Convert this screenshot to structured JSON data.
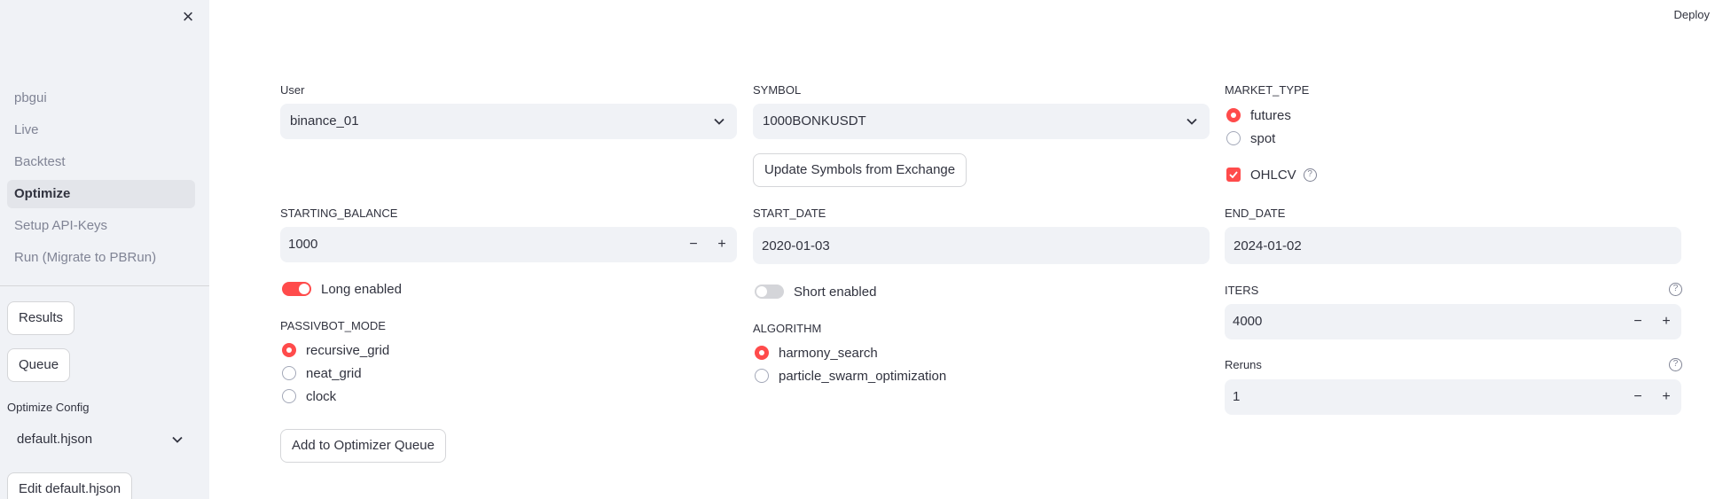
{
  "sidebar": {
    "close_icon": "close-icon",
    "nav": [
      {
        "label": "pbgui"
      },
      {
        "label": "Live"
      },
      {
        "label": "Backtest"
      },
      {
        "label": "Optimize"
      },
      {
        "label": "Setup API-Keys"
      },
      {
        "label": "Run (Migrate to PBRun)"
      }
    ],
    "active_index": 3,
    "results_label": "Results",
    "queue_label": "Queue",
    "config_label": "Optimize Config",
    "config_value": "default.hjson",
    "edit_label": "Edit default.hjson"
  },
  "header": {
    "deploy_label": "Deploy"
  },
  "form": {
    "user": {
      "label": "User",
      "value": "binance_01"
    },
    "symbol": {
      "label": "SYMBOL",
      "value": "1000BONKUSDT"
    },
    "update_symbols_label": "Update Symbols from Exchange",
    "market_type": {
      "label": "MARKET_TYPE",
      "options": [
        "futures",
        "spot"
      ],
      "selected": "futures"
    },
    "ohlcv": {
      "label": "OHLCV",
      "checked": true
    },
    "starting_balance": {
      "label": "STARTING_BALANCE",
      "value": "1000"
    },
    "start_date": {
      "label": "START_DATE",
      "value": "2020-01-03"
    },
    "end_date": {
      "label": "END_DATE",
      "value": "2024-01-02"
    },
    "long_enabled": {
      "label": "Long enabled",
      "on": true
    },
    "short_enabled": {
      "label": "Short enabled",
      "on": false
    },
    "iters": {
      "label": "ITERS",
      "value": "4000"
    },
    "passivbot_mode": {
      "label": "PASSIVBOT_MODE",
      "options": [
        "recursive_grid",
        "neat_grid",
        "clock"
      ],
      "selected": "recursive_grid"
    },
    "algorithm": {
      "label": "ALGORITHM",
      "options": [
        "harmony_search",
        "particle_swarm_optimization"
      ],
      "selected": "harmony_search"
    },
    "reruns": {
      "label": "Reruns",
      "value": "1"
    },
    "add_queue_label": "Add to Optimizer Queue",
    "stepper_minus": "−",
    "stepper_plus": "+",
    "help_glyph": "?"
  },
  "colors": {
    "accent": "#ff4b4b",
    "sidebar_bg": "#f0f2f6",
    "input_bg": "#f0f2f6",
    "text": "#31333f",
    "muted": "#808495"
  }
}
